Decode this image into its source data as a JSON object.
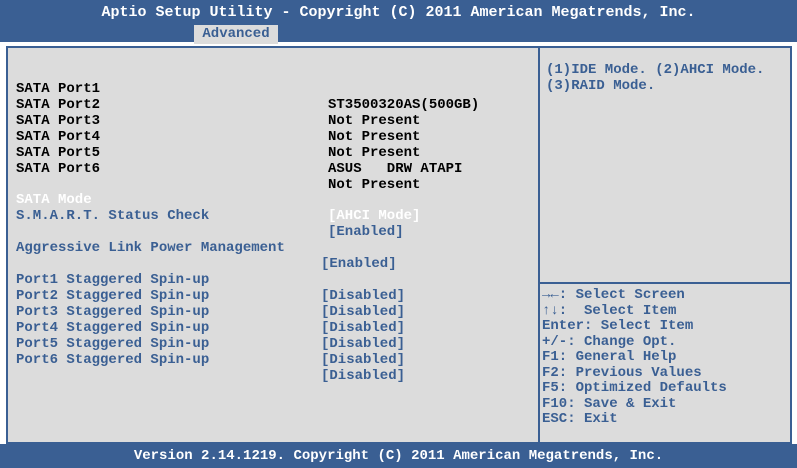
{
  "header": {
    "title": "Aptio Setup Utility - Copyright (C) 2011 American Megatrends, Inc.",
    "tab": "Advanced"
  },
  "info_rows": [
    {
      "label": "SATA Port1",
      "value": "ST3500320AS(500GB)"
    },
    {
      "label": "SATA Port2",
      "value": "Not Present"
    },
    {
      "label": "SATA Port3",
      "value": "Not Present"
    },
    {
      "label": "SATA Port4",
      "value": "Not Present"
    },
    {
      "label": "SATA Port5",
      "value": "ASUS   DRW ATAPI"
    },
    {
      "label": "SATA Port6",
      "value": "Not Present"
    }
  ],
  "settings": {
    "sata_mode": {
      "label": "SATA Mode",
      "value": "[AHCI Mode]"
    },
    "smart": {
      "label": "S.M.A.R.T. Status Check",
      "value": "[Enabled]"
    },
    "alpm": {
      "label": "Aggressive Link Power Management",
      "value": "[Enabled]"
    },
    "spinup": [
      {
        "label": "Port1 Staggered Spin-up",
        "value": "[Disabled]"
      },
      {
        "label": "Port2 Staggered Spin-up",
        "value": "[Disabled]"
      },
      {
        "label": "Port3 Staggered Spin-up",
        "value": "[Disabled]"
      },
      {
        "label": "Port4 Staggered Spin-up",
        "value": "[Disabled]"
      },
      {
        "label": "Port5 Staggered Spin-up",
        "value": "[Disabled]"
      },
      {
        "label": "Port6 Staggered Spin-up",
        "value": "[Disabled]"
      }
    ]
  },
  "help": {
    "line1": "(1)IDE Mode. (2)AHCI Mode.",
    "line2": "(3)RAID Mode."
  },
  "keys": [
    "→←: Select Screen",
    "↑↓:  Select Item",
    "Enter: Select Item",
    "+/-: Change Opt.",
    "F1: General Help",
    "F2: Previous Values",
    "F5: Optimized Defaults",
    "F10: Save & Exit",
    "ESC: Exit"
  ],
  "footer": "Version 2.14.1219. Copyright (C) 2011 American Megatrends, Inc.",
  "colors": {
    "frame_blue": "#3a5f93",
    "panel_gray": "#dcdcdc",
    "selected": "#ffffff"
  }
}
